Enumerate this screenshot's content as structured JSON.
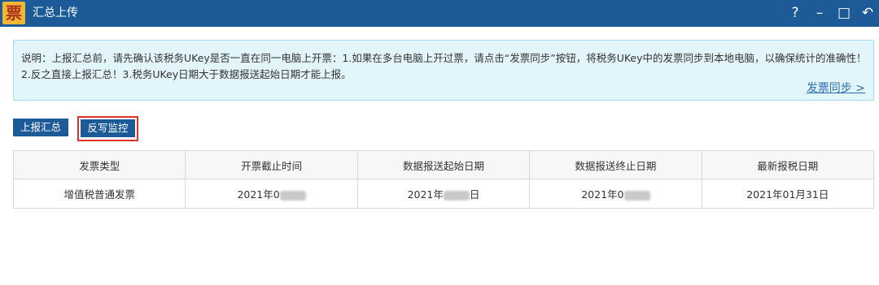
{
  "titlebar": {
    "logo_char": "票",
    "title": "汇总上传",
    "help": "?",
    "minimize": "–",
    "maximize": "□",
    "back": "↶"
  },
  "notice": {
    "text": "说明：上报汇总前，请先确认该税务UKey是否一直在同一电脑上开票：1.如果在多台电脑上开过票，请点击“发票同步”按钮，将税务UKey中的发票同步到本地电脑，以确保统计的准确性！2.反之直接上报汇总！3.税务UKey日期大于数据报送起始日期才能上报。",
    "sync_link": "发票同步 >"
  },
  "buttons": {
    "report_summary": "上报汇总",
    "reverse_monitor": "反写监控"
  },
  "table": {
    "headers": [
      "发票类型",
      "开票截止时间",
      "数据报送起始日期",
      "数据报送终止日期",
      "最新报税日期"
    ],
    "row": {
      "invoice_type": "增值税普通发票",
      "deadline_prefix": "2021年0",
      "start_prefix": "2021年",
      "start_suffix": "日",
      "end_prefix": "2021年0",
      "latest_date": "2021年01月31日"
    }
  },
  "colors": {
    "titlebar": "#1c5a98",
    "notice_bg": "#e2f5fb",
    "highlight_border": "#e0302a",
    "link": "#2a6fb0"
  }
}
